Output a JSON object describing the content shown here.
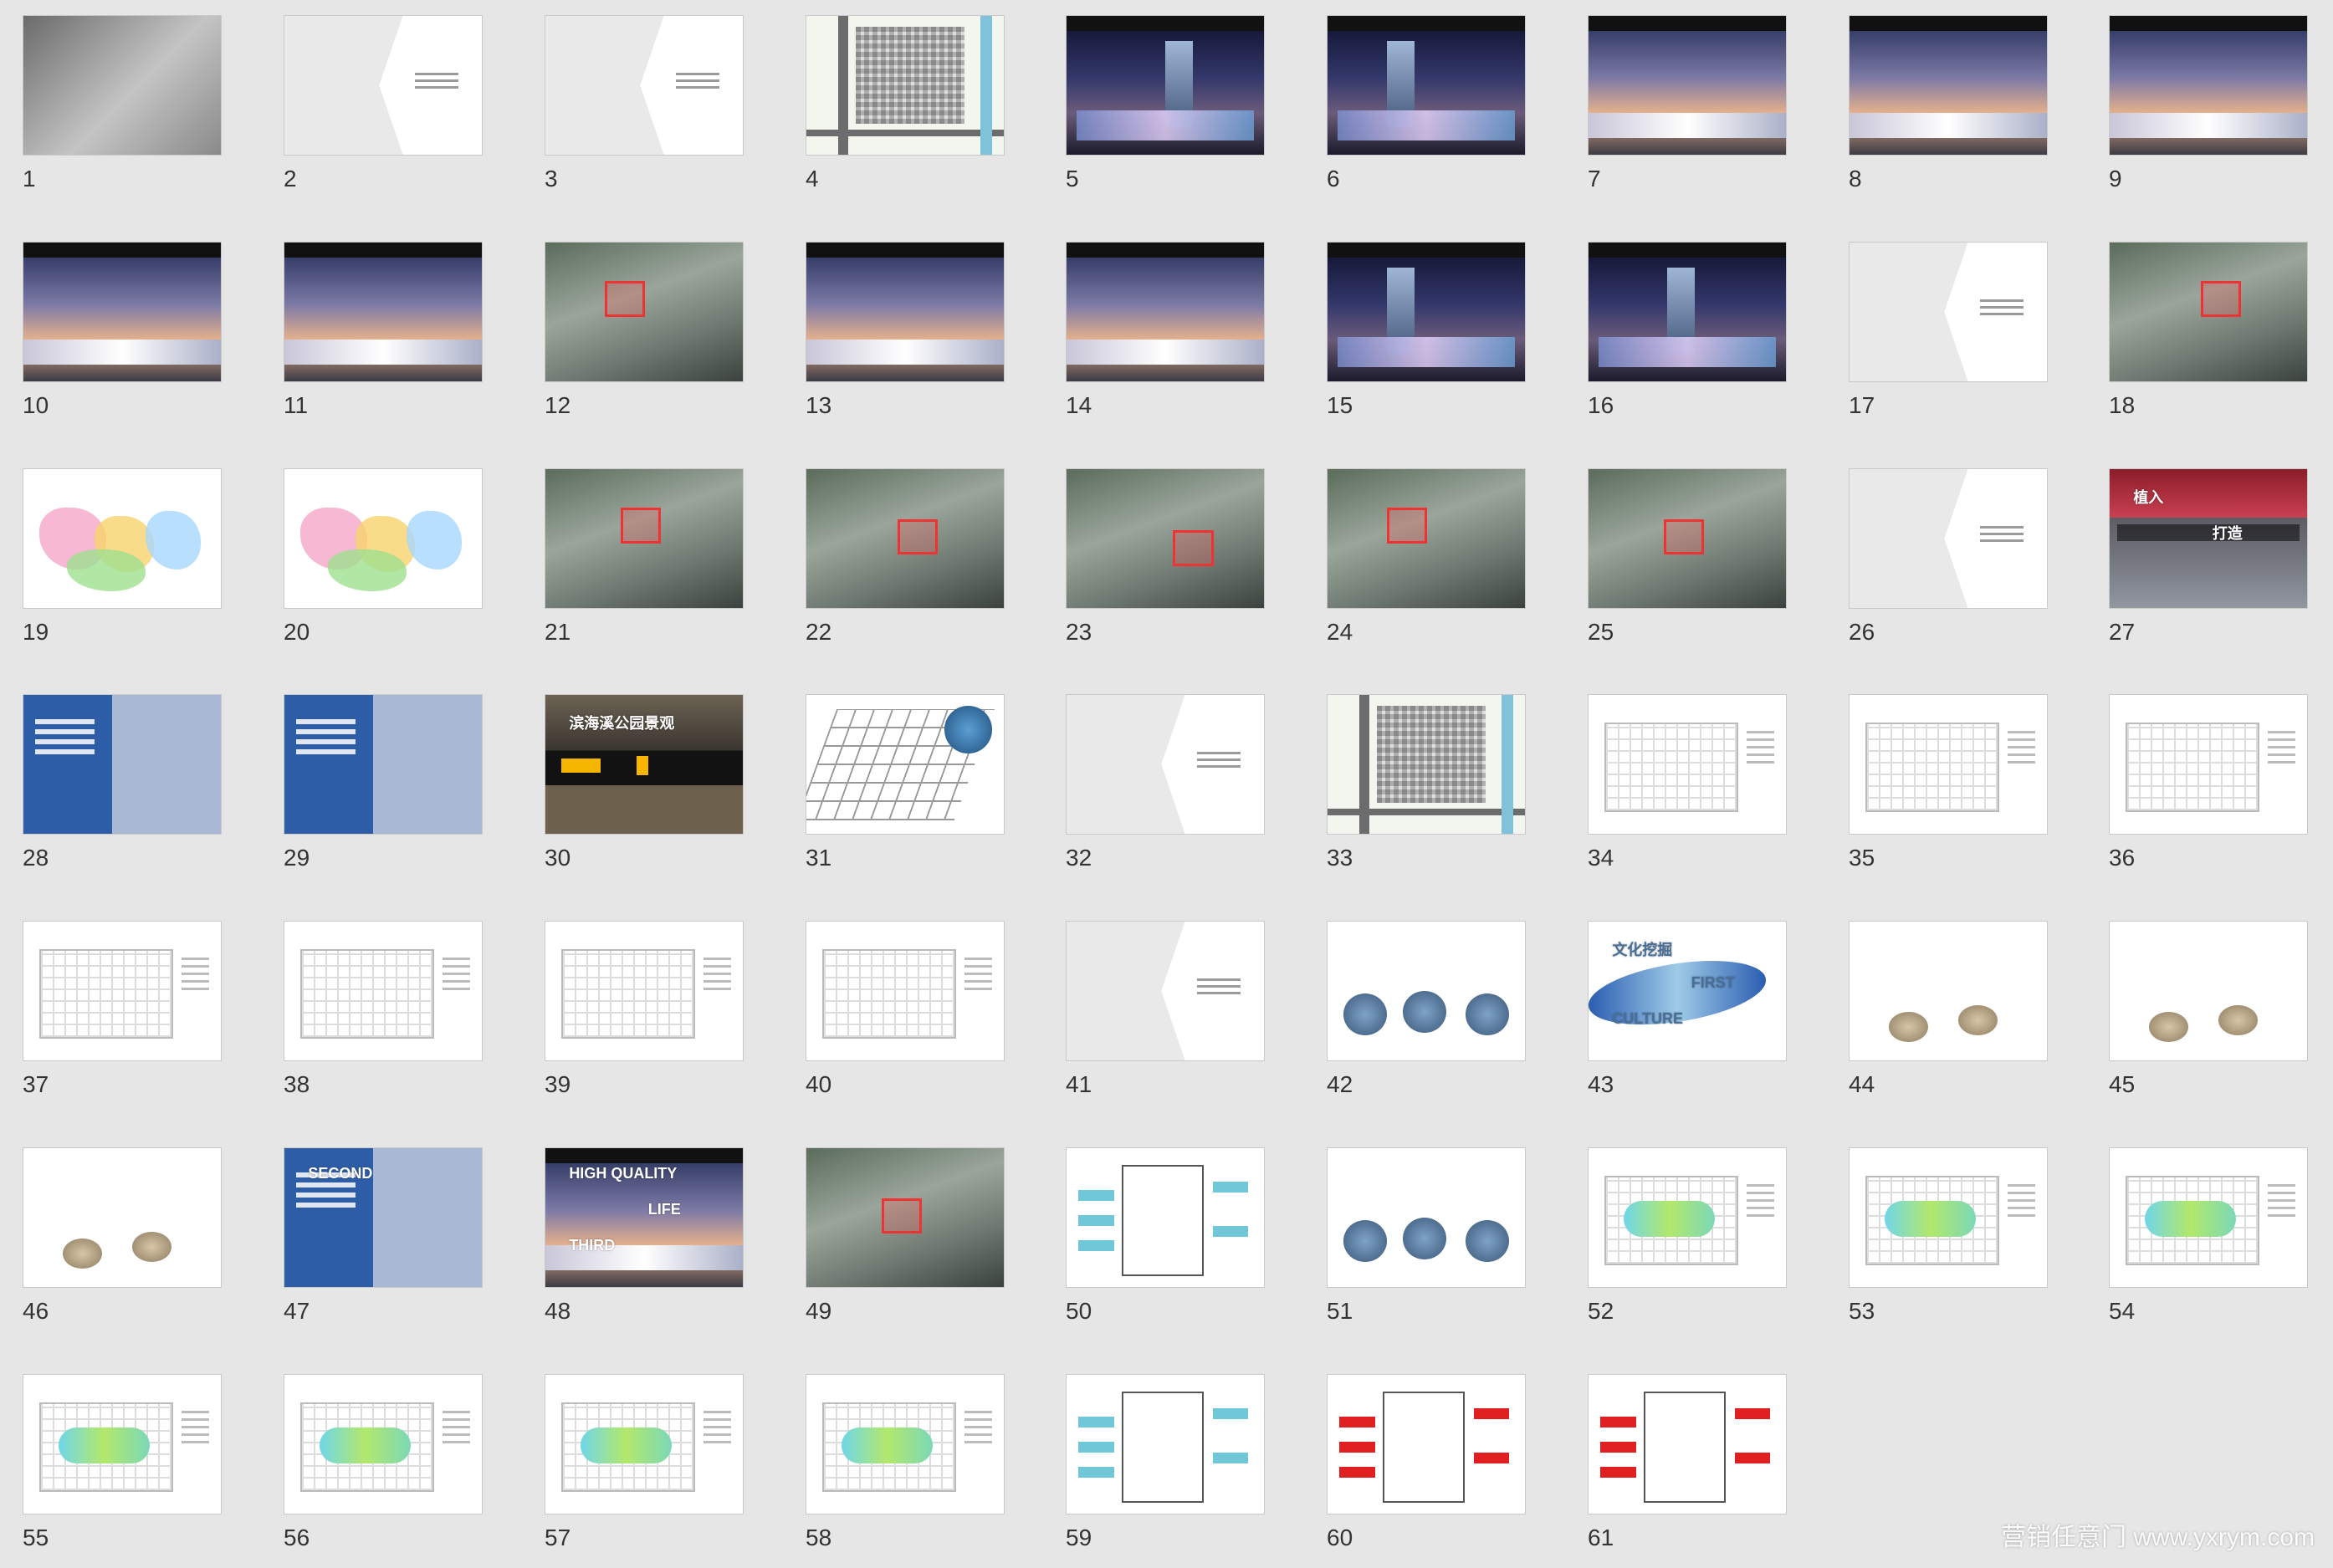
{
  "app": {
    "view": "slide-sorter"
  },
  "slides": [
    {
      "n": "1",
      "theme": "cover"
    },
    {
      "n": "2",
      "theme": "chevron"
    },
    {
      "n": "3",
      "theme": "chevron"
    },
    {
      "n": "4",
      "theme": "map"
    },
    {
      "n": "5",
      "theme": "night"
    },
    {
      "n": "6",
      "theme": "night"
    },
    {
      "n": "7",
      "theme": "dusk"
    },
    {
      "n": "8",
      "theme": "dusk"
    },
    {
      "n": "9",
      "theme": "dusk"
    },
    {
      "n": "10",
      "theme": "dusk"
    },
    {
      "n": "11",
      "theme": "dusk"
    },
    {
      "n": "12",
      "theme": "aerial"
    },
    {
      "n": "13",
      "theme": "dusk"
    },
    {
      "n": "14",
      "theme": "dusk"
    },
    {
      "n": "15",
      "theme": "night"
    },
    {
      "n": "16",
      "theme": "night"
    },
    {
      "n": "17",
      "theme": "chevron"
    },
    {
      "n": "18",
      "theme": "aerial"
    },
    {
      "n": "19",
      "theme": "zones"
    },
    {
      "n": "20",
      "theme": "zones"
    },
    {
      "n": "21",
      "theme": "aerial"
    },
    {
      "n": "22",
      "theme": "aerial"
    },
    {
      "n": "23",
      "theme": "aerial"
    },
    {
      "n": "24",
      "theme": "aerial"
    },
    {
      "n": "25",
      "theme": "aerial"
    },
    {
      "n": "26",
      "theme": "chevron"
    },
    {
      "n": "27",
      "theme": "red-top"
    },
    {
      "n": "28",
      "theme": "blue"
    },
    {
      "n": "29",
      "theme": "blue"
    },
    {
      "n": "30",
      "theme": "dark-band"
    },
    {
      "n": "31",
      "theme": "iso"
    },
    {
      "n": "32",
      "theme": "chevron"
    },
    {
      "n": "33",
      "theme": "map"
    },
    {
      "n": "34",
      "theme": "plan"
    },
    {
      "n": "35",
      "theme": "plan"
    },
    {
      "n": "36",
      "theme": "plan"
    },
    {
      "n": "37",
      "theme": "plan"
    },
    {
      "n": "38",
      "theme": "plan"
    },
    {
      "n": "39",
      "theme": "plan"
    },
    {
      "n": "40",
      "theme": "plan"
    },
    {
      "n": "41",
      "theme": "chevron"
    },
    {
      "n": "42",
      "theme": "circles"
    },
    {
      "n": "43",
      "theme": "wave"
    },
    {
      "n": "44",
      "theme": "words"
    },
    {
      "n": "45",
      "theme": "words"
    },
    {
      "n": "46",
      "theme": "words"
    },
    {
      "n": "47",
      "theme": "blue"
    },
    {
      "n": "48",
      "theme": "dusk"
    },
    {
      "n": "49",
      "theme": "aerial"
    },
    {
      "n": "50",
      "theme": "drawing"
    },
    {
      "n": "51",
      "theme": "circles"
    },
    {
      "n": "52",
      "theme": "plan"
    },
    {
      "n": "53",
      "theme": "plan"
    },
    {
      "n": "54",
      "theme": "plan"
    },
    {
      "n": "55",
      "theme": "plan"
    },
    {
      "n": "56",
      "theme": "plan"
    },
    {
      "n": "57",
      "theme": "plan"
    },
    {
      "n": "58",
      "theme": "plan"
    },
    {
      "n": "59",
      "theme": "drawing"
    },
    {
      "n": "60",
      "theme": "drawing"
    },
    {
      "n": "61",
      "theme": "drawing"
    }
  ],
  "slide_text": {
    "27": [
      "植入",
      "打造"
    ],
    "30": [
      "滨海溪公园景观"
    ],
    "43": [
      "文化挖掘",
      "FIRST",
      "CULTURE"
    ],
    "47": [
      "SECOND"
    ],
    "48": [
      "HIGH QUALITY",
      "LIFE",
      "THIRD"
    ]
  },
  "watermark": "营销任意门 www.yxrym.com"
}
